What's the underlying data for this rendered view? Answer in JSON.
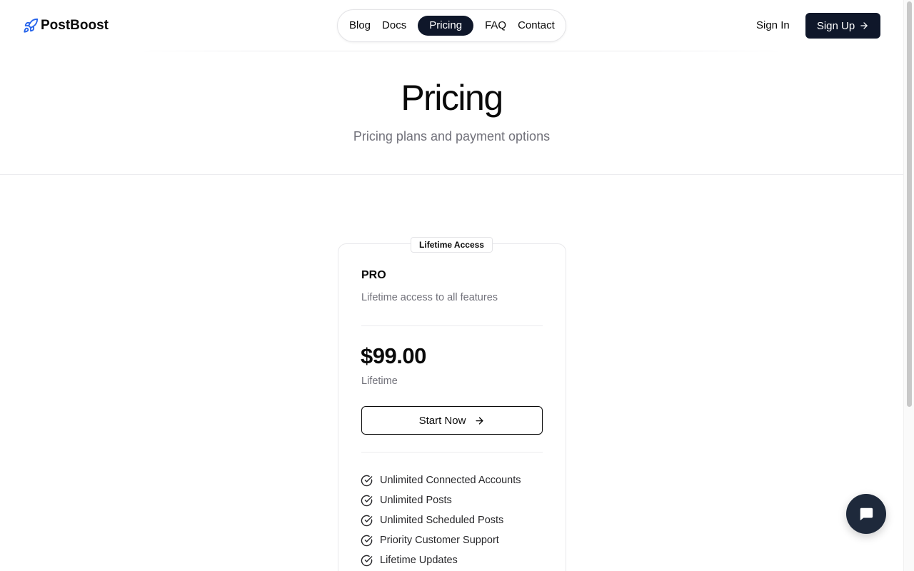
{
  "brand": {
    "name": "PostBoost",
    "icon": "rocket-icon",
    "color": "#2563eb"
  },
  "nav": {
    "items": [
      {
        "label": "Blog",
        "active": false
      },
      {
        "label": "Docs",
        "active": false
      },
      {
        "label": "Pricing",
        "active": true
      },
      {
        "label": "FAQ",
        "active": false
      },
      {
        "label": "Contact",
        "active": false
      }
    ]
  },
  "auth": {
    "sign_in": "Sign In",
    "sign_up": "Sign Up"
  },
  "hero": {
    "title": "Pricing",
    "subtitle": "Pricing plans and payment options"
  },
  "plan": {
    "badge": "Lifetime Access",
    "name": "PRO",
    "description": "Lifetime access to all features",
    "price": "$99.00",
    "period": "Lifetime",
    "cta": "Start Now",
    "features": [
      "Unlimited Connected Accounts",
      "Unlimited Posts",
      "Unlimited Scheduled Posts",
      "Priority Customer Support",
      "Lifetime Updates"
    ]
  },
  "colors": {
    "primary_dark": "#0f172a",
    "chat_bg": "#1e293b",
    "muted_text": "#71717a"
  },
  "icons": {
    "arrow": "arrow-right-icon",
    "check": "check-circle-icon",
    "chat": "chat-bubble-icon"
  }
}
